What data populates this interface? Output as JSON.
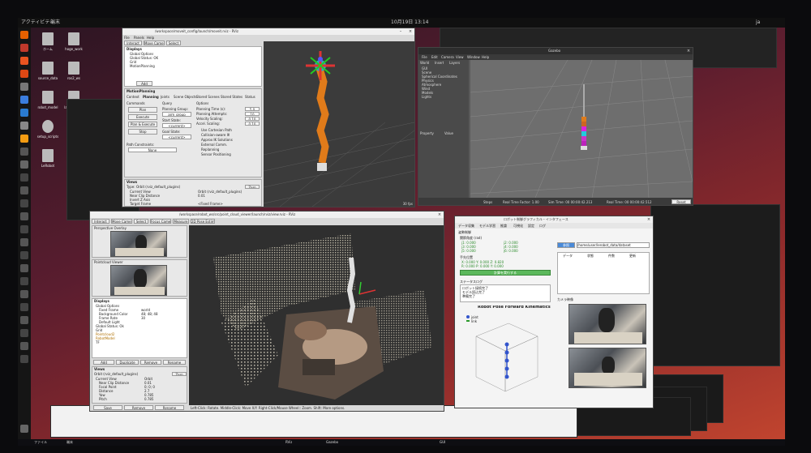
{
  "topbar": {
    "activities": "アクティビティ",
    "app": "端末",
    "clock": "10月19日 13:14",
    "tray": "ja"
  },
  "desktop_icons": [
    {
      "label": "ホーム"
    },
    {
      "label": "hoge_work"
    },
    {
      "label": "source_data"
    },
    {
      "label": "ros2_ws"
    },
    {
      "label": "robot_model"
    },
    {
      "label": "launch_files"
    },
    {
      "label": "setup_scripts"
    },
    {
      "label": "config"
    },
    {
      "label": "LeRobot"
    },
    {
      "label": "Pretrain"
    }
  ],
  "moveit_window": {
    "title": "/workspace/moveit_config/launch/moveit.rviz - RViz",
    "menu": [
      "File",
      "Panels",
      "Help"
    ],
    "toolbar": [
      "Interact",
      "Move Camera",
      "Select"
    ],
    "displays_title": "Displays",
    "display_items": [
      "Global Options",
      "Global Status: OK",
      "Grid",
      "MotionPlanning"
    ],
    "add_label": "Add",
    "plugin_title": "MotionPlanning",
    "tabs": [
      "Context",
      "Planning",
      "Joints",
      "Scene Objects",
      "Stored Scenes",
      "Stored States",
      "Status"
    ],
    "planning": {
      "commands": "Commands",
      "plan": "Plan",
      "execute": "Execute",
      "plan_execute": "Plan & Execute",
      "stop": "Stop",
      "query": "Query",
      "planning_group": "Planning Group:",
      "group_value": "arm_group",
      "start_state": "Start State:",
      "start_value": "<current>",
      "goal_state": "Goal State:",
      "goal_value": "<current>",
      "options": "Options",
      "planning_time": "Planning Time (s):",
      "planning_time_value": "5.0",
      "attempts": "Planning Attempts:",
      "attempts_value": "10",
      "velocity": "Velocity Scaling:",
      "velocity_value": "0.10",
      "accel": "Accel. Scaling:",
      "accel_value": "0.10",
      "use_cartesian": "Use Cartesian Path",
      "collision_aware": "Collision-aware IK",
      "approx_ik": "Approx IK Solutions",
      "external_comm": "External Comm.",
      "replanning": "Replanning",
      "sensor_position": "Sensor Positioning",
      "path_constraints": "Path Constraints:",
      "path_value": "None"
    },
    "views_title": "Views",
    "views_type_label": "Type:",
    "views_type": "Orbit (rviz_default_plugins)",
    "zero_label": "Zero",
    "views_rows": [
      "Current View",
      "Near Clip Distance",
      "Invert Z Axis",
      "Target Frame"
    ],
    "views_values": [
      "Orbit (rviz_default_plugins)",
      "0.01",
      "",
      "<Fixed Frame>"
    ],
    "bottom_btns": [
      "Save",
      "Remove",
      "Rename"
    ],
    "fps": "30 fps"
  },
  "gazebo_window": {
    "title": "Gazebo",
    "menu": [
      "File",
      "Edit",
      "Camera",
      "View",
      "Window",
      "Help"
    ],
    "left_tabs": [
      "World",
      "Insert",
      "Layers"
    ],
    "tree": [
      "GUI",
      "Scene",
      "Spherical Coordinates",
      "Physics",
      "Atmosphere",
      "Wind",
      "Models",
      "Lights"
    ],
    "prop_headers": [
      "Property",
      "Value"
    ],
    "status": [
      "Steps",
      "Real Time Factor: 1.00",
      "Sim Time: 00 00:00:42.213",
      "Real Time: 00 00:00:42.512",
      "Iterations: 42213"
    ],
    "reset": "Reset"
  },
  "rviz_window": {
    "title": "/workspace/robot_ws/src/point_cloud_viewer/launch/rviz/view.rviz - RViz",
    "toolbar": [
      "Interact",
      "Move Camera",
      "Select",
      "Focus Camera",
      "Measure",
      "2D Pose Estimate"
    ],
    "panels": [
      "Perspective Overlay",
      "Pointcloud Viewer"
    ],
    "displays_title": "Displays",
    "display_items": [
      "Global Options",
      "Fixed Frame",
      "Background Color",
      "Frame Rate",
      "Default Light",
      "Global Status: Ok",
      "Grid",
      "Pointcloud2",
      "RobotModel",
      "TF"
    ],
    "display_values": [
      "",
      "world",
      "48; 48; 48",
      "30",
      "",
      "",
      "",
      "",
      "",
      ""
    ],
    "btns": [
      "Add",
      "Duplicate",
      "Remove",
      "Rename"
    ],
    "views_title": "Views",
    "views_type": "Orbit (rviz_default_plugins)",
    "zero_label": "Zero",
    "views_rows": [
      "Current View",
      "Near Clip Distance",
      "Focal Point",
      "Distance",
      "Yaw",
      "Pitch",
      "Field of View",
      "Target Frame"
    ],
    "views_values": [
      "Orbit",
      "0.01",
      "0; 0; 0",
      "2.7",
      "0.785",
      "0.785",
      "0.785",
      "<Fixed Frame>"
    ],
    "bottom_btns": [
      "Save",
      "Remove",
      "Rename"
    ],
    "status": "Left-Click: Rotate. Middle-Click: Move X/Y. Right-Click/Mouse Wheel:: Zoom. Shift: More options."
  },
  "gui_window": {
    "title": "ロボット制御グラフィカル・インタフェース",
    "tabs": [
      "データ収集",
      "モデル学習",
      "推論",
      "可視化",
      "設定",
      "ログ"
    ],
    "section": "姿勢制御",
    "joint_label": "関節角度 (rad)",
    "joints": [
      "j1: 0.000",
      "j2: 0.000",
      "j3: 0.000",
      "j4: 0.000",
      "j5: 0.000",
      "j6: 0.000"
    ],
    "fk_label": "手先位置",
    "fk_values": [
      "X: 0.000  Y: 0.000  Z: 0.820",
      "R: 0.000  P: 0.000  Y: 0.000"
    ],
    "fk_button": "計算を実行する",
    "log_label": "ステータスログ",
    "log_lines": [
      "ロボット接続完了",
      "モデル読込完了",
      "準備完了"
    ],
    "right_button": "参照",
    "path": "/home/user/lerobot_data/dataset",
    "table_headers": [
      "データ",
      "状態",
      "件数",
      "更新"
    ],
    "camera_label": "カメラ映像",
    "plot_title": "Robot Pose Forward Kinematics",
    "legend": [
      "joint",
      "link"
    ]
  },
  "taskbar": {
    "items": [
      "ファイル",
      "端末",
      "RViz",
      "Gazebo",
      "GUI"
    ]
  },
  "colors": {
    "accent_green": "#5cb85c",
    "viewport": "#3b3b3b",
    "robot_orange": "#e07b1a"
  },
  "chart_data": {
    "type": "scatter",
    "title": "Robot Pose Forward Kinematics",
    "series": [
      {
        "name": "joint",
        "values": []
      },
      {
        "name": "link",
        "values": []
      }
    ]
  }
}
